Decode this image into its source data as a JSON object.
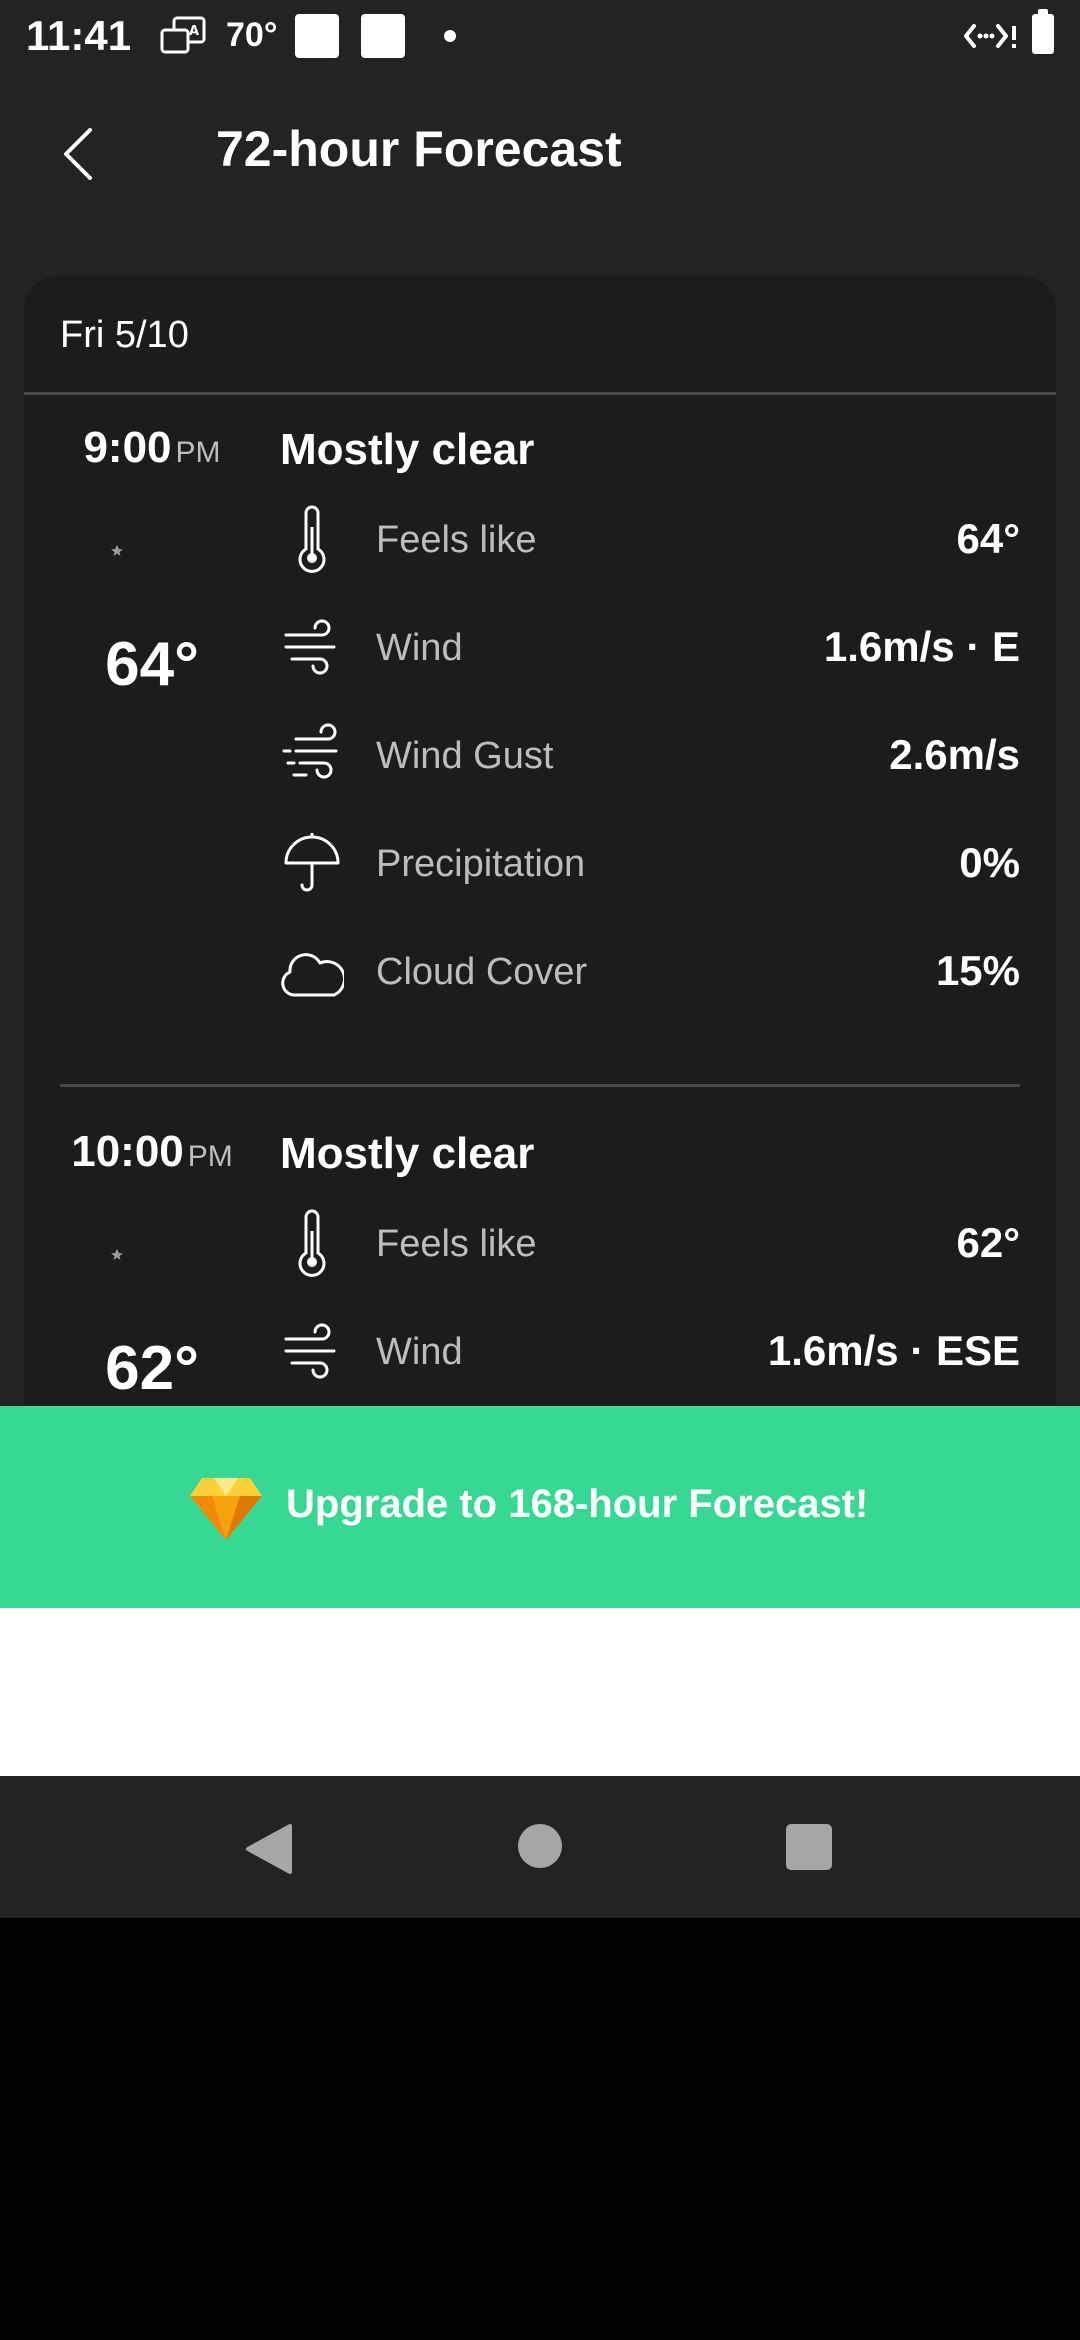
{
  "status_bar": {
    "time": "11:41",
    "temperature": "70°",
    "icons": [
      "translate-icon",
      "square-icon",
      "square-icon",
      "dot-icon",
      "network-icon",
      "battery-icon"
    ]
  },
  "header": {
    "title": "72-hour Forecast",
    "back_icon": "back-chevron-icon"
  },
  "forecast": {
    "date": "Fri 5/10",
    "hours": [
      {
        "time": "9:00",
        "ampm": "PM",
        "temp": "64°",
        "condition": "Mostly clear",
        "condition_icon": "moon-icon",
        "details": [
          {
            "label": "Feels like",
            "value": "64°",
            "icon": "thermometer-icon"
          },
          {
            "label": "Wind",
            "value": "1.6m/s · E",
            "icon": "wind-icon"
          },
          {
            "label": "Wind Gust",
            "value": "2.6m/s",
            "icon": "wind-gust-icon"
          },
          {
            "label": "Precipitation",
            "value": "0%",
            "icon": "umbrella-icon"
          },
          {
            "label": "Cloud Cover",
            "value": "15%",
            "icon": "cloud-icon"
          }
        ]
      },
      {
        "time": "10:00",
        "ampm": "PM",
        "temp": "62°",
        "condition": "Mostly clear",
        "condition_icon": "moon-icon",
        "details": [
          {
            "label": "Feels like",
            "value": "62°",
            "icon": "thermometer-icon"
          },
          {
            "label": "Wind",
            "value": "1.6m/s · ESE",
            "icon": "wind-icon"
          }
        ]
      }
    ]
  },
  "upgrade": {
    "label": "Upgrade to 168-hour Forecast!",
    "icon": "gem-icon"
  },
  "colors": {
    "background": "#232323",
    "card": "#1c1c1c",
    "accent_green": "#36d893",
    "moon_blue": "#5bb4f5"
  }
}
